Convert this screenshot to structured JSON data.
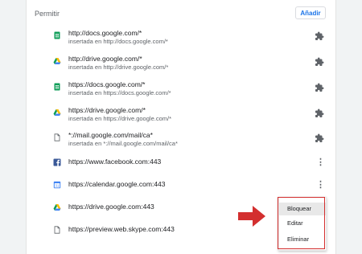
{
  "section": {
    "title": "Permitir",
    "add_label": "Añadir"
  },
  "colors": {
    "accent": "#1a73e8",
    "highlight": "#d32f2f"
  },
  "rows": [
    {
      "icon": "google-sheets-icon",
      "line1": "http://docs.google.com/*",
      "line2": "insertada en http://docs.google.com/*",
      "action": "extension-icon"
    },
    {
      "icon": "google-drive-icon",
      "line1": "http://drive.google.com/*",
      "line2": "insertada en http://drive.google.com/*",
      "action": "extension-icon"
    },
    {
      "icon": "google-sheets-icon",
      "line1": "https://docs.google.com/*",
      "line2": "insertada en https://docs.google.com/*",
      "action": "extension-icon"
    },
    {
      "icon": "google-drive-icon",
      "line1": "https://drive.google.com/*",
      "line2": "insertada en https://drive.google.com/*",
      "action": "extension-icon"
    },
    {
      "icon": "document-icon",
      "line1": "*://mail.google.com/mail/ca*",
      "line2": "insertada en *://mail.google.com/mail/ca*",
      "action": "extension-icon"
    },
    {
      "icon": "facebook-icon",
      "line1": "https://www.facebook.com:443",
      "line2": "",
      "action": "more-vert-icon"
    },
    {
      "icon": "google-calendar-icon",
      "line1": "https://calendar.google.com:443",
      "line2": "",
      "action": "more-vert-icon"
    },
    {
      "icon": "google-drive-icon",
      "line1": "https://drive.google.com:443",
      "line2": "",
      "action": "none"
    },
    {
      "icon": "document-icon",
      "line1": "https://preview.web.skype.com:443",
      "line2": "",
      "action": "none"
    }
  ],
  "menu": {
    "items": [
      "Bloquear",
      "Editar",
      "Eliminar"
    ]
  }
}
